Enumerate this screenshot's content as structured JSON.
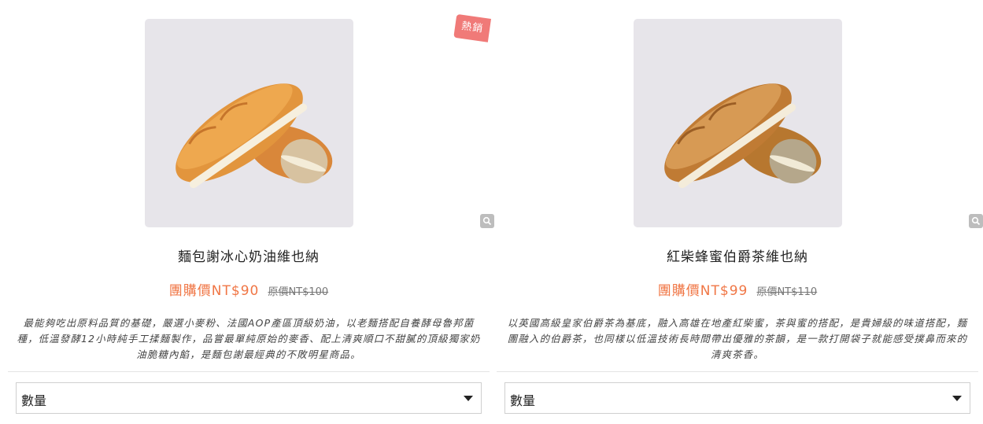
{
  "products": [
    {
      "title": "麵包謝冰心奶油維也納",
      "badge": "熱銷",
      "price_now": "團購價NT$90",
      "price_old": "原價NT$100",
      "description": "最能夠吃出原料品質的基礎，嚴選小麥粉、法國AOP產區頂級奶油，以老麵搭配自養酵母魯邦菌種，低溫發酵12小時純手工揉麵製作，品嘗最單純原始的麥香、配上清爽順口不甜膩的頂級獨家奶油脆糖內餡，是麵包謝最經典的不敗明星商品。",
      "quantity_label": "數量",
      "image_icon": "bread-photo",
      "zoom_icon": "magnifier-icon"
    },
    {
      "title": "紅柴蜂蜜伯爵茶維也納",
      "price_now": "團購價NT$99",
      "price_old": "原價NT$110",
      "description": "以英國高級皇家伯爵茶為基底，融入高雄在地產紅柴蜜，茶與蜜的搭配，是貴婦級的味道搭配，麵團融入的伯爵茶，也同樣以低溫技術長時間帶出優雅的茶韻，是一款打開袋子就能感受撲鼻而來的清爽茶香。",
      "quantity_label": "數量",
      "image_icon": "bread-photo",
      "zoom_icon": "magnifier-icon"
    }
  ],
  "colors": {
    "accent_price": "#f07645",
    "badge_bg": "#f07a78",
    "image_bg": "#e7e5ea"
  }
}
